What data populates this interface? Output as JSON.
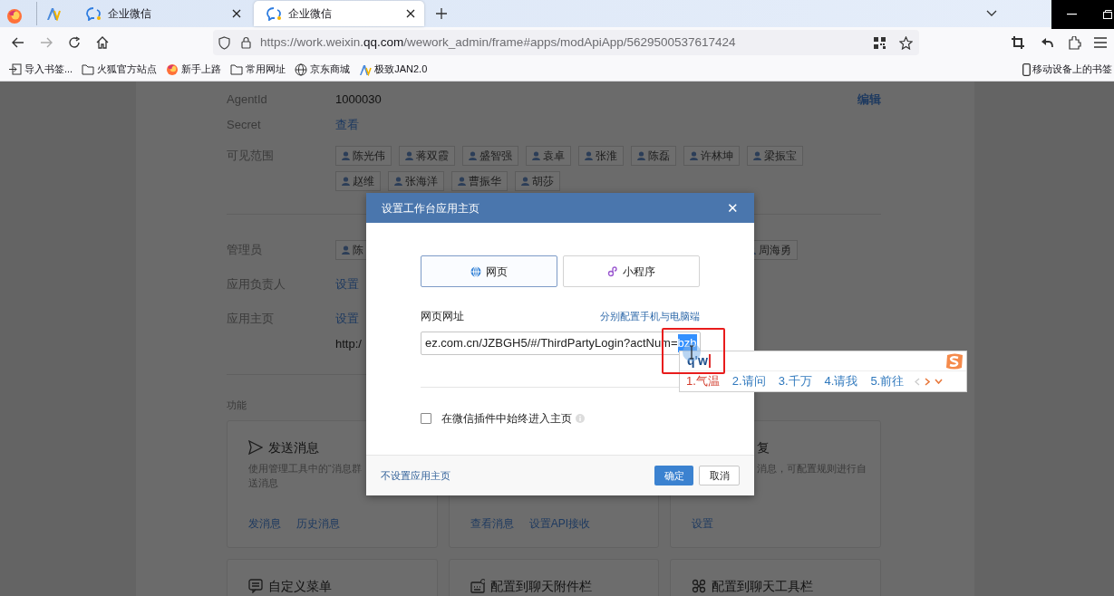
{
  "browser": {
    "tabs": [
      {
        "kind": "pinned",
        "selected": false
      },
      {
        "kind": "page",
        "title": "企业微信",
        "selected": false
      },
      {
        "kind": "page",
        "title": "企业微信",
        "selected": true
      }
    ],
    "url": {
      "prefix": "https://work.weixin.",
      "domain": "qq.com",
      "path": "/wework_admin/frame#apps/modApiApp/5629500537617424"
    },
    "bookmarks": [
      {
        "kind": "import",
        "label": "导入书签..."
      },
      {
        "kind": "folder",
        "label": "火狐官方站点"
      },
      {
        "kind": "firefox",
        "label": "新手上路"
      },
      {
        "kind": "folder",
        "label": "常用网址"
      },
      {
        "kind": "globe",
        "label": "京东商城"
      },
      {
        "kind": "av",
        "label": "极致JAN2.0"
      }
    ],
    "mobile_bookmarks": "移动设备上的书签"
  },
  "page": {
    "basic": [
      {
        "kind": "text",
        "label": "AgentId",
        "value": "1000030",
        "action": "编辑"
      },
      {
        "kind": "link",
        "label": "Secret",
        "value": "查看"
      },
      {
        "kind": "tags",
        "label": "可见范围",
        "tags": [
          "陈光伟",
          "蒋双霞",
          "盛智强",
          "袁卓",
          "张淮",
          "陈磊",
          "许林坤",
          "梁振宝",
          "赵维",
          "张海洋",
          "曹振华",
          "胡莎"
        ]
      }
    ],
    "manage": [
      {
        "kind": "tags",
        "label": "管理员",
        "tags": [
          "陈",
          "周海勇"
        ]
      },
      {
        "kind": "link",
        "label": "应用负责人",
        "value": "设置"
      },
      {
        "kind": "link",
        "label": "应用主页",
        "value": "设置",
        "extra": "http:/"
      }
    ],
    "features_title": "功能",
    "cards": [
      {
        "kind": "full",
        "title": "发送消息",
        "description_lines": [
          "使用管理工具中的“消息群",
          "送消息"
        ],
        "links": [
          "发消息",
          "历史消息"
        ]
      },
      {
        "kind": "hidden",
        "links": [
          "查看消息",
          "设置API接收"
        ]
      },
      {
        "kind": "clipped",
        "title": "复",
        "description_lines": [
          "消息，可配置规则进行自"
        ],
        "links": [
          "设置"
        ]
      },
      {
        "kind": "full",
        "title": "自定义菜单"
      },
      {
        "kind": "full",
        "title": "配置到聊天附件栏"
      },
      {
        "kind": "full",
        "title": "配置到聊天工具栏"
      }
    ]
  },
  "dialog": {
    "title": "设置工作台应用主页",
    "close": "✕",
    "modes": [
      {
        "kind": "web",
        "label": "网页",
        "selected": true
      },
      {
        "kind": "mini",
        "label": "小程序",
        "selected": false
      }
    ],
    "url_label": "网页网址",
    "url_link": "分别配置手机与电脑端",
    "url_value": "ez.com.cn/JZBGH5/#/ThirdPartyLogin?actNum=",
    "url_selected": "bzb",
    "checkbox": {
      "label": "在微信插件中始终进入主页",
      "checked": false
    },
    "no_homepage": "不设置应用主页",
    "ok": "确定",
    "cancel": "取消"
  },
  "ime": {
    "composition": "q'w",
    "candidates": [
      {
        "label": "1.气温",
        "selected": true
      },
      {
        "label": "2.请问",
        "selected": false
      },
      {
        "label": "3.千万",
        "selected": false
      },
      {
        "label": "4.请我",
        "selected": false
      },
      {
        "label": "5.前往",
        "selected": false
      }
    ]
  }
}
